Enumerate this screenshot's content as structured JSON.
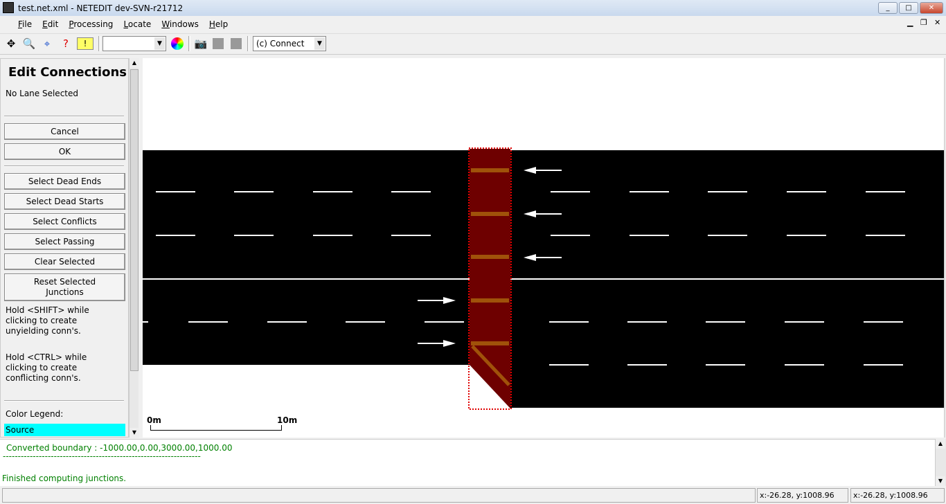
{
  "window": {
    "title": "test.net.xml - NETEDIT dev-SVN-r21712",
    "min": "_",
    "max": "□",
    "close": "✕"
  },
  "menu": [
    "File",
    "Edit",
    "Processing",
    "Locate",
    "Windows",
    "Help"
  ],
  "toolbar": {
    "mode_combo": "(c) Connect",
    "scheme_combo": ""
  },
  "panel": {
    "title": "Edit Connections",
    "status": "No Lane Selected",
    "buttons": {
      "cancel": "Cancel",
      "ok": "OK",
      "dead_ends": "Select Dead Ends",
      "dead_starts": "Select Dead Starts",
      "conflicts": "Select Conflicts",
      "passing": "Select Passing",
      "clear": "Clear Selected",
      "reset1": "Reset Selected",
      "reset2": "Junctions"
    },
    "hint_shift": [
      "Hold <SHIFT> while",
      "clicking to create",
      "unyielding conn's."
    ],
    "hint_ctrl": [
      "Hold <CTRL> while",
      "clicking to create",
      "conflicting conn's."
    ],
    "legend_label": "Color Legend:",
    "legend_source": "Source",
    "legend_source_color": "#00ffff"
  },
  "scale": {
    "start": "0m",
    "end": "10m"
  },
  "log": {
    "line1": "Converted boundary : -1000.00,0.00,3000.00,1000.00",
    "line2": "------------------------------------------------------------------",
    "line3": "Finished computing junctions."
  },
  "status": {
    "coord1": "x:-26.28, y:1008.96",
    "coord2": "x:-26.28, y:1008.96"
  },
  "colors": {
    "road": "#000000",
    "junction": "#6e0000",
    "connection": "#a0520a",
    "selection": "#e00000"
  }
}
